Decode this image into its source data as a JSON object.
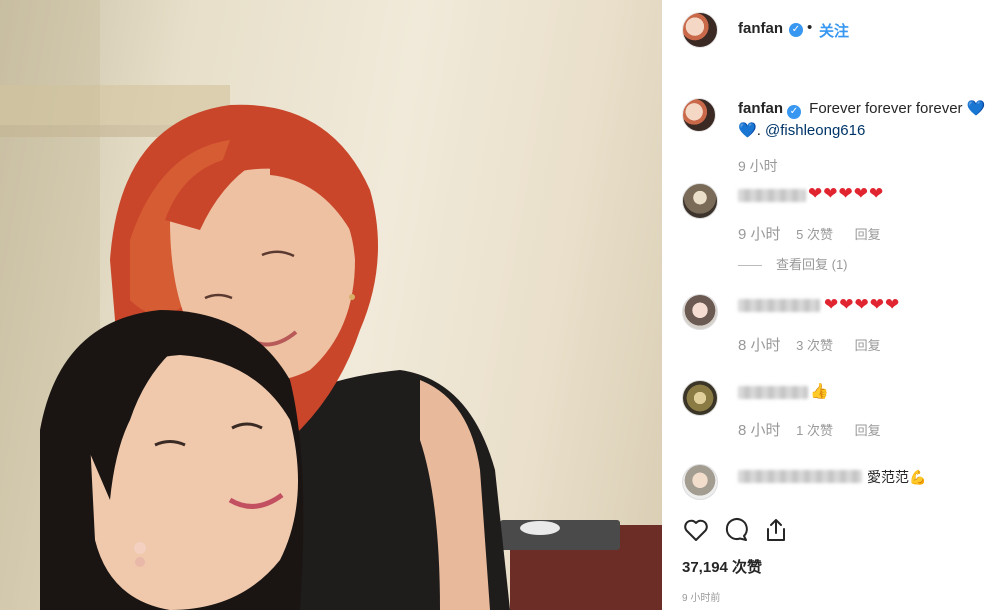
{
  "post": {
    "username": "fanfan",
    "verified_mark": "✓",
    "separator": "•",
    "follow_label": "关注",
    "caption": {
      "username": "fanfan",
      "text": "Forever forever forever",
      "heart1": "💙",
      "heart2": "💙",
      "punct": ".",
      "mention": "@fishleong616"
    },
    "caption_time": "9 小时",
    "likes_count": "37,194 次赞",
    "post_time": "9 小时前"
  },
  "comments": [
    {
      "text": "❤❤❤❤❤",
      "time": "9 小时",
      "likes": "5 次赞",
      "reply_label": "回复",
      "view_replies": "查看回复 (1)"
    },
    {
      "text": "❤❤❤❤❤",
      "time": "8 小时",
      "likes": "3 次赞",
      "reply_label": "回复"
    },
    {
      "text": "👍",
      "time": "8 小时",
      "likes": "1 次赞",
      "reply_label": "回复"
    },
    {
      "text": "愛范范💪"
    }
  ],
  "icons": {
    "like": "heart-outline-icon",
    "comment": "comment-bubble-icon",
    "share": "share-upload-icon"
  },
  "colors": {
    "accent": "#3897f0",
    "heart_red": "#e02430",
    "hair_red": "#c9462a",
    "muted": "#999999"
  }
}
